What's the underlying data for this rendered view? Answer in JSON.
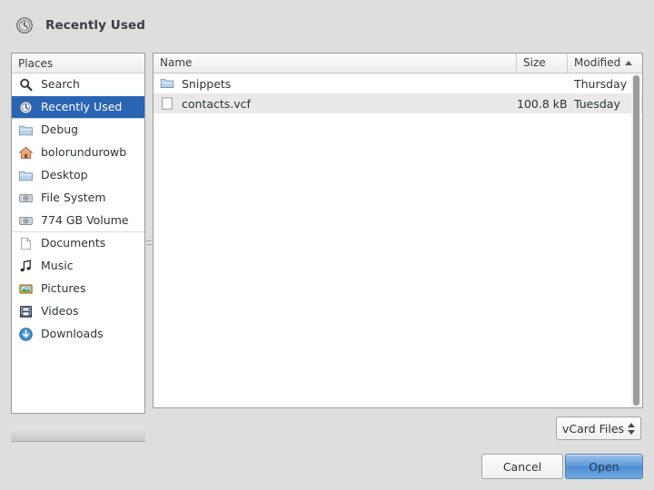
{
  "window": {
    "title": "Recently Used",
    "title_icon": "recent-clock-icon"
  },
  "sidebar": {
    "header": "Places",
    "items": [
      {
        "label": "Search",
        "icon": "search-icon",
        "selected": false
      },
      {
        "label": "Recently Used",
        "icon": "recent-icon",
        "selected": true
      },
      {
        "label": "Debug",
        "icon": "folder-icon",
        "selected": false
      },
      {
        "label": "bolorundurowb",
        "icon": "home-icon",
        "selected": false
      },
      {
        "label": "Desktop",
        "icon": "folder-icon",
        "selected": false
      },
      {
        "label": "File System",
        "icon": "drive-icon",
        "selected": false
      },
      {
        "label": "774 GB Volume",
        "icon": "drive-icon",
        "selected": false
      },
      {
        "label": "Documents",
        "icon": "document-icon",
        "selected": false
      },
      {
        "label": "Music",
        "icon": "music-icon",
        "selected": false
      },
      {
        "label": "Pictures",
        "icon": "pictures-icon",
        "selected": false
      },
      {
        "label": "Videos",
        "icon": "video-icon",
        "selected": false
      },
      {
        "label": "Downloads",
        "icon": "download-icon",
        "selected": false
      }
    ]
  },
  "filelist": {
    "columns": {
      "name": "Name",
      "size": "Size",
      "modified": "Modified"
    },
    "sort": {
      "column": "Modified",
      "direction": "ascending",
      "glyph": "▲"
    },
    "rows": [
      {
        "name": "Snippets",
        "icon": "folder-icon",
        "size": "",
        "modified": "Thursday",
        "selected": false
      },
      {
        "name": "contacts.vcf",
        "icon": "file-icon",
        "size": "100.8 kB",
        "modified": "Tuesday",
        "selected": true
      }
    ]
  },
  "footer": {
    "filter": "vCard Files",
    "cancel_label": "Cancel",
    "open_label": "Open"
  },
  "colors": {
    "background": "#dededd",
    "selection": "#2a64b4",
    "accent_button": "#5d9ad9",
    "row_highlight": "#e9e9e9"
  }
}
